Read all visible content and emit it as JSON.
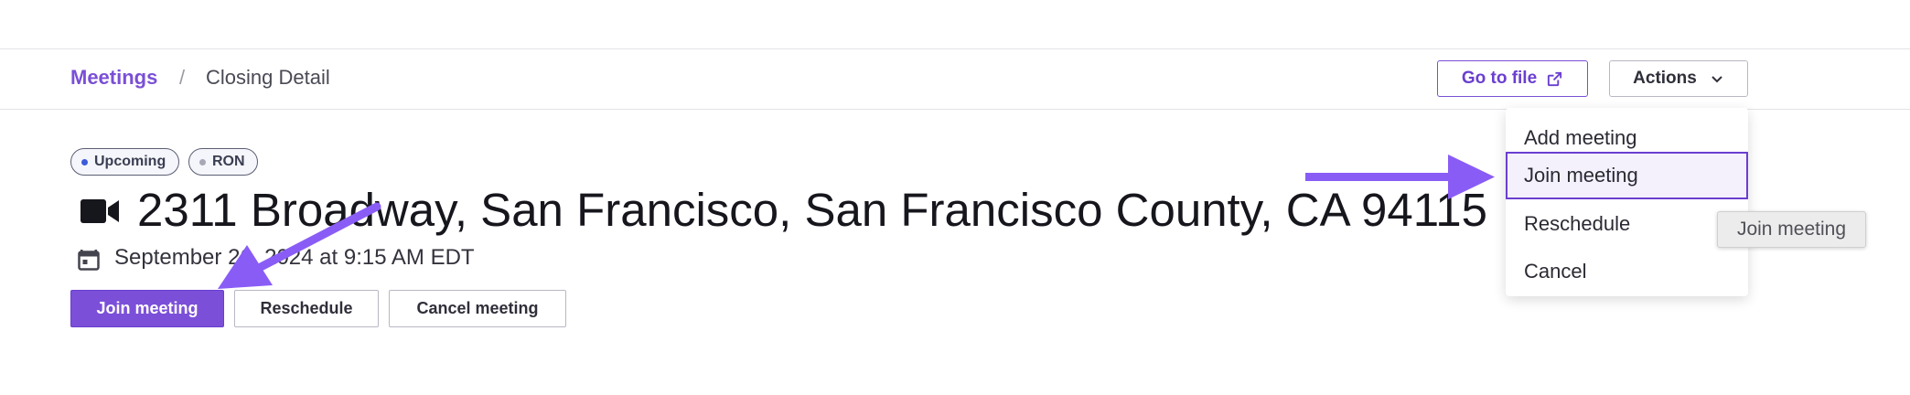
{
  "breadcrumb": {
    "root": "Meetings",
    "separator": "/",
    "current": "Closing Detail"
  },
  "header": {
    "goto_file_label": "Go to file",
    "goto_file_icon": "external-link-icon",
    "actions_label": "Actions",
    "actions_icon": "chevron-down-icon"
  },
  "actions_menu": {
    "items": [
      {
        "label": "Add meeting"
      },
      {
        "label": "Join meeting",
        "highlighted": true
      },
      {
        "label": "Reschedule"
      },
      {
        "label": "Cancel"
      }
    ]
  },
  "tooltip": {
    "text": "Join meeting"
  },
  "badges": [
    {
      "label": "Upcoming",
      "dot_color": "#3b5bdb"
    },
    {
      "label": "RON",
      "dot_color": "#a7a7b6"
    }
  ],
  "meeting": {
    "icon": "video-camera-icon",
    "title": "2311 Broadway, San Francisco, San Francisco County, CA 94115",
    "date_icon": "calendar-icon",
    "date": "September 26, 2024 at 9:15 AM EDT"
  },
  "buttons": {
    "join": "Join meeting",
    "reschedule": "Reschedule",
    "cancel": "Cancel meeting"
  },
  "colors": {
    "accent": "#7b4fd8",
    "annotation_arrow": "#8a5cf6"
  }
}
